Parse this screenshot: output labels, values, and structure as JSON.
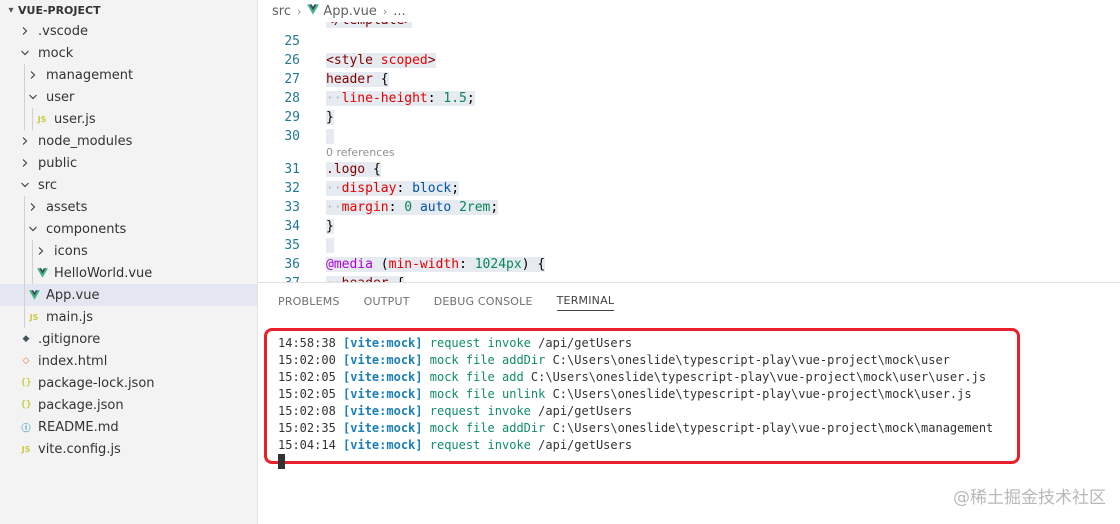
{
  "explorer": {
    "project": "VUE-PROJECT",
    "items": [
      {
        "label": ".vscode",
        "type": "folder",
        "open": false,
        "depth": 1
      },
      {
        "label": "mock",
        "type": "folder",
        "open": true,
        "depth": 1
      },
      {
        "label": "management",
        "type": "folder",
        "open": false,
        "depth": 2
      },
      {
        "label": "user",
        "type": "folder",
        "open": true,
        "depth": 2
      },
      {
        "label": "user.js",
        "type": "js",
        "depth": 3
      },
      {
        "label": "node_modules",
        "type": "folder",
        "open": false,
        "depth": 1
      },
      {
        "label": "public",
        "type": "folder",
        "open": false,
        "depth": 1
      },
      {
        "label": "src",
        "type": "folder",
        "open": true,
        "depth": 1
      },
      {
        "label": "assets",
        "type": "folder",
        "open": false,
        "depth": 2
      },
      {
        "label": "components",
        "type": "folder",
        "open": true,
        "depth": 2
      },
      {
        "label": "icons",
        "type": "folder",
        "open": false,
        "depth": 3
      },
      {
        "label": "HelloWorld.vue",
        "type": "vue",
        "depth": 3
      },
      {
        "label": "App.vue",
        "type": "vue",
        "depth": 2,
        "selected": true
      },
      {
        "label": "main.js",
        "type": "js",
        "depth": 2
      },
      {
        "label": ".gitignore",
        "type": "git",
        "depth": 1
      },
      {
        "label": "index.html",
        "type": "html",
        "depth": 1
      },
      {
        "label": "package-lock.json",
        "type": "json",
        "depth": 1
      },
      {
        "label": "package.json",
        "type": "json",
        "depth": 1
      },
      {
        "label": "README.md",
        "type": "info",
        "depth": 1
      },
      {
        "label": "vite.config.js",
        "type": "js",
        "depth": 1
      }
    ]
  },
  "breadcrumb": {
    "folder": "src",
    "file": "App.vue",
    "more": "..."
  },
  "editor": {
    "codelens": "0 references",
    "lines": {
      "l25": "25",
      "l26": "26",
      "l27": "27",
      "l28": "28",
      "l29": "29",
      "l30": "30",
      "l31": "31",
      "l32": "32",
      "l33": "33",
      "l34": "34",
      "l35": "35",
      "l36": "36",
      "l37": "37"
    }
  },
  "panel": {
    "tabs": [
      "PROBLEMS",
      "OUTPUT",
      "DEBUG CONSOLE",
      "TERMINAL"
    ],
    "active_tab": "TERMINAL",
    "terminal_lines": [
      {
        "time": "14:58:38",
        "tag": "[vite:mock]",
        "msg": "request invoke",
        "path": "/api/getUsers"
      },
      {
        "time": "15:02:00",
        "tag": "[vite:mock]",
        "msg": "mock file addDir",
        "path": "C:\\Users\\oneslide\\typescript-play\\vue-project\\mock\\user"
      },
      {
        "time": "15:02:05",
        "tag": "[vite:mock]",
        "msg": "mock file add",
        "path": "C:\\Users\\oneslide\\typescript-play\\vue-project\\mock\\user\\user.js"
      },
      {
        "time": "15:02:05",
        "tag": "[vite:mock]",
        "msg": "mock file unlink",
        "path": "C:\\Users\\oneslide\\typescript-play\\vue-project\\mock\\user.js"
      },
      {
        "time": "15:02:08",
        "tag": "[vite:mock]",
        "msg": "request invoke",
        "path": "/api/getUsers"
      },
      {
        "time": "15:02:35",
        "tag": "[vite:mock]",
        "msg": "mock file addDir",
        "path": "C:\\Users\\oneslide\\typescript-play\\vue-project\\mock\\management"
      },
      {
        "time": "15:04:14",
        "tag": "[vite:mock]",
        "msg": "request invoke",
        "path": "/api/getUsers"
      }
    ]
  },
  "watermark": "@稀土掘金技术社区",
  "colors": {
    "highlight_box": "#e8202b",
    "terminal_tag": "#1b7fb7",
    "terminal_msg": "#108c69"
  }
}
